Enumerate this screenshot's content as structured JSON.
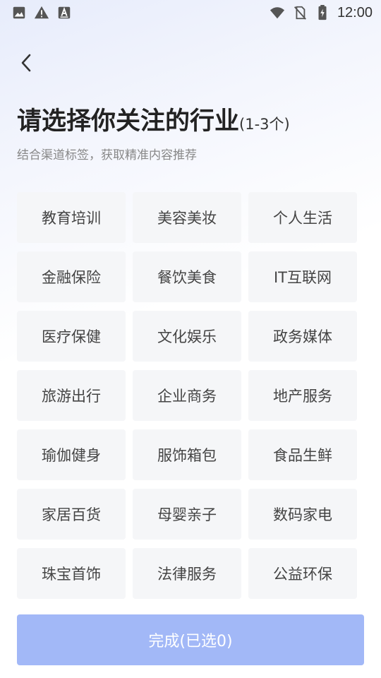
{
  "status_bar": {
    "time": "12:00",
    "left_icons": [
      "image-icon",
      "warning-icon",
      "font-a-icon"
    ],
    "right_icons": [
      "wifi-icon",
      "no-sim-icon",
      "battery-charging-icon"
    ]
  },
  "header": {
    "title": "请选择你关注的行业",
    "title_hint": "(1-3个)",
    "subtitle": "结合渠道标签，获取精准内容推荐"
  },
  "tags": [
    "教育培训",
    "美容美妆",
    "个人生活",
    "金融保险",
    "餐饮美食",
    "IT互联网",
    "医疗保健",
    "文化娱乐",
    "政务媒体",
    "旅游出行",
    "企业商务",
    "地产服务",
    "瑜伽健身",
    "服饰箱包",
    "食品生鲜",
    "家居百货",
    "母婴亲子",
    "数码家电",
    "珠宝首饰",
    "法律服务",
    "公益环保"
  ],
  "done_button": {
    "label": "完成(已选0)"
  },
  "colors": {
    "accent_disabled": "#a2b8f7",
    "tag_bg": "#f5f6f8"
  }
}
